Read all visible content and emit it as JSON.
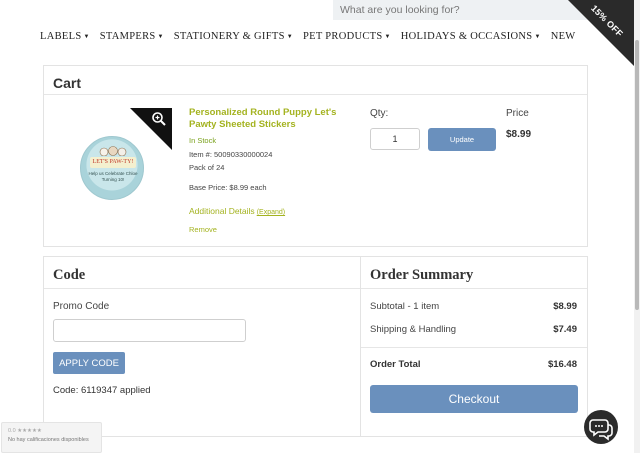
{
  "search": {
    "placeholder": "What are you looking for?"
  },
  "promo_corner": {
    "text": "15% OFF"
  },
  "nav": {
    "items": [
      {
        "label": "LABELS",
        "has_dropdown": true
      },
      {
        "label": "STAMPERS",
        "has_dropdown": true
      },
      {
        "label": "STATIONERY & GIFTS",
        "has_dropdown": true
      },
      {
        "label": "PET PRODUCTS",
        "has_dropdown": true
      },
      {
        "label": "HOLIDAYS & OCCASIONS",
        "has_dropdown": true
      },
      {
        "label": "NEW",
        "has_dropdown": false
      }
    ]
  },
  "cart": {
    "title": "Cart",
    "item": {
      "name": "Personalized Round Puppy Let's Pawty Sheeted Stickers",
      "stock": "In Stock",
      "item_number": "Item #: 50090330000024",
      "pack": "Pack of 24",
      "base_price": "Base Price: $8.99 each",
      "additional_details": "Additional Details",
      "expand": "(Expand)",
      "remove": "Remove",
      "sticker_banner": "LET'S PAW-TY!",
      "sticker_subtext": "Help us Celebrate Chloe Turning 10!"
    },
    "qty_label": "Qty:",
    "qty_value": "1",
    "update_label": "Update",
    "price_label": "Price",
    "price": "$8.99"
  },
  "code": {
    "title": "Code",
    "promo_label": "Promo Code",
    "promo_value": "",
    "apply_label": "APPLY CODE",
    "applied_text": "Code: 6119347 applied"
  },
  "summary": {
    "title": "Order Summary",
    "subtotal_label": "Subtotal - 1 item",
    "subtotal_value": "$8.99",
    "shipping_label": "Shipping & Handling",
    "shipping_value": "$7.49",
    "total_label": "Order Total",
    "total_value": "$16.48",
    "checkout_label": "Checkout"
  },
  "review_widget": {
    "rating": "0.0",
    "text": "No hay calificaciones disponibles"
  },
  "colors": {
    "accent_button": "#6a90bd",
    "product_link": "#a4b320",
    "in_stock": "#7aa11d"
  },
  "icons": [
    "magnifier-plus-icon",
    "chat-bubbles-icon",
    "caret-down-icon"
  ]
}
